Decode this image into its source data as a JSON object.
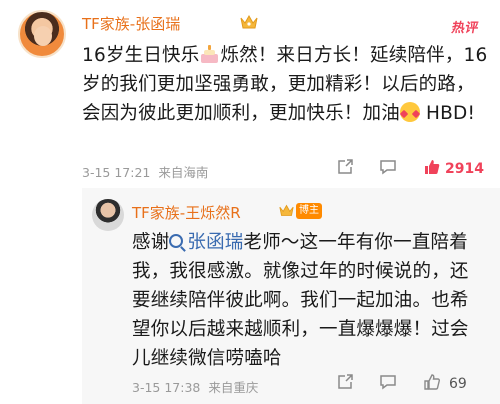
{
  "main_comment": {
    "author": "TF家族-张函瑞",
    "hot_label": "热评",
    "text_before_cake": "16岁生日快乐",
    "text_after_cake": "烁然！来日方长！延续陪伴，16岁的我们更加坚强勇敢，更加精彩！以后的路，会因为彼此更加顺利，更加快乐！加油",
    "text_after_face": "HBD!",
    "date": "3-15 17:21",
    "location": "来自海南",
    "like_count": "2914"
  },
  "reply": {
    "author": "TF家族-王烁然R",
    "badge": "博主",
    "text_before_mention": "感谢",
    "mention": "张函瑞",
    "text_after_mention": "老师～这一年有你一直陪着我，我很感激。就像过年的时候说的，还要继续陪伴彼此啊。我们一起加油。也希望你以后越来越顺利，一直爆爆爆！过会儿继续微信唠嗑哈",
    "date": "3-15 17:38",
    "location": "来自重庆",
    "like_count": "69"
  },
  "colors": {
    "name": "#e8701a",
    "hot": "#f0425a",
    "mention": "#3a6bb0",
    "badge_bg": "#ff8a00"
  },
  "icons": [
    "crown-icon",
    "cake-icon",
    "love-face-icon",
    "share-icon",
    "reply-icon",
    "like-icon",
    "mention-search-icon"
  ]
}
